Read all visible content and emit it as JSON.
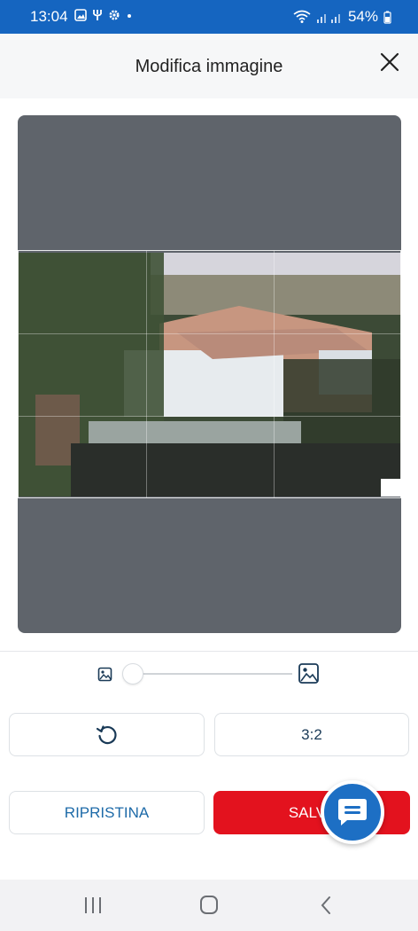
{
  "status_bar": {
    "time": "13:04",
    "battery": "54%"
  },
  "header": {
    "title": "Modifica immagine"
  },
  "zoom": {
    "level": 0.0
  },
  "buttons": {
    "ratio_label": "3:2",
    "reset_label": "RIPRISTINA",
    "save_label": "SALVA"
  },
  "colors": {
    "status_bar": "#1565c0",
    "save_button": "#e3121e",
    "chat_button": "#1d6fc4",
    "reset_text": "#1d6aa8"
  },
  "icons": {
    "close": "close-icon",
    "rotate": "rotate-icon",
    "zoom_out": "image-small-icon",
    "zoom_in": "image-large-icon",
    "chat": "chat-icon"
  }
}
